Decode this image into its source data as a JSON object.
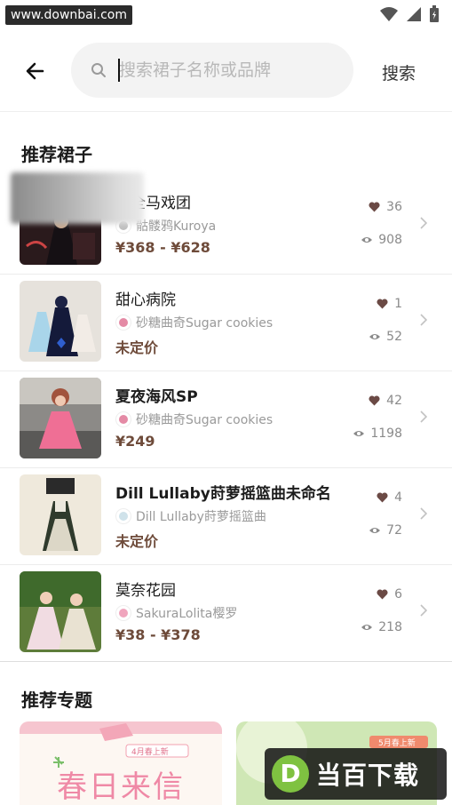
{
  "watermark_top": "www.downbai.com",
  "search": {
    "placeholder": "搜索裙子名称或品牌",
    "button_label": "搜索"
  },
  "sections": {
    "recommended_skirts": "推荐裙子",
    "recommended_topics": "推荐专题"
  },
  "items": [
    {
      "name": "…全马戏团",
      "brand": "骷髅鸦Kuroya",
      "price": "¥368 - ¥628",
      "likes": "36",
      "views": "908"
    },
    {
      "name": "甜心病院",
      "brand": "砂糖曲奇Sugar cookies",
      "price": "未定价",
      "likes": "1",
      "views": "52"
    },
    {
      "name": "夏夜海风SP",
      "brand": "砂糖曲奇Sugar cookies",
      "price": "¥249",
      "likes": "42",
      "views": "1198"
    },
    {
      "name": "Dill Lullaby莳萝摇篮曲未命名",
      "brand": "Dill Lullaby莳萝摇篮曲",
      "price": "未定价",
      "likes": "4",
      "views": "72"
    },
    {
      "name": "莫奈花园",
      "brand": "SakuraLolita樱罗",
      "price": "¥38 - ¥378",
      "likes": "6",
      "views": "218"
    }
  ],
  "topics": [
    {
      "title": "春日来信",
      "tag": "4月春上新"
    },
    {
      "title": "",
      "tag": "5月春上新"
    }
  ],
  "watermark_bottom": "当百下载",
  "icons": {
    "back": "arrow-left-icon",
    "search": "magnifier-icon",
    "like": "heart-icon",
    "view": "eye-icon",
    "chevron": "chevron-right-icon"
  },
  "colors": {
    "price": "#6e4b3a",
    "heart": "#6b4a45",
    "muted": "#8a8a8a"
  }
}
